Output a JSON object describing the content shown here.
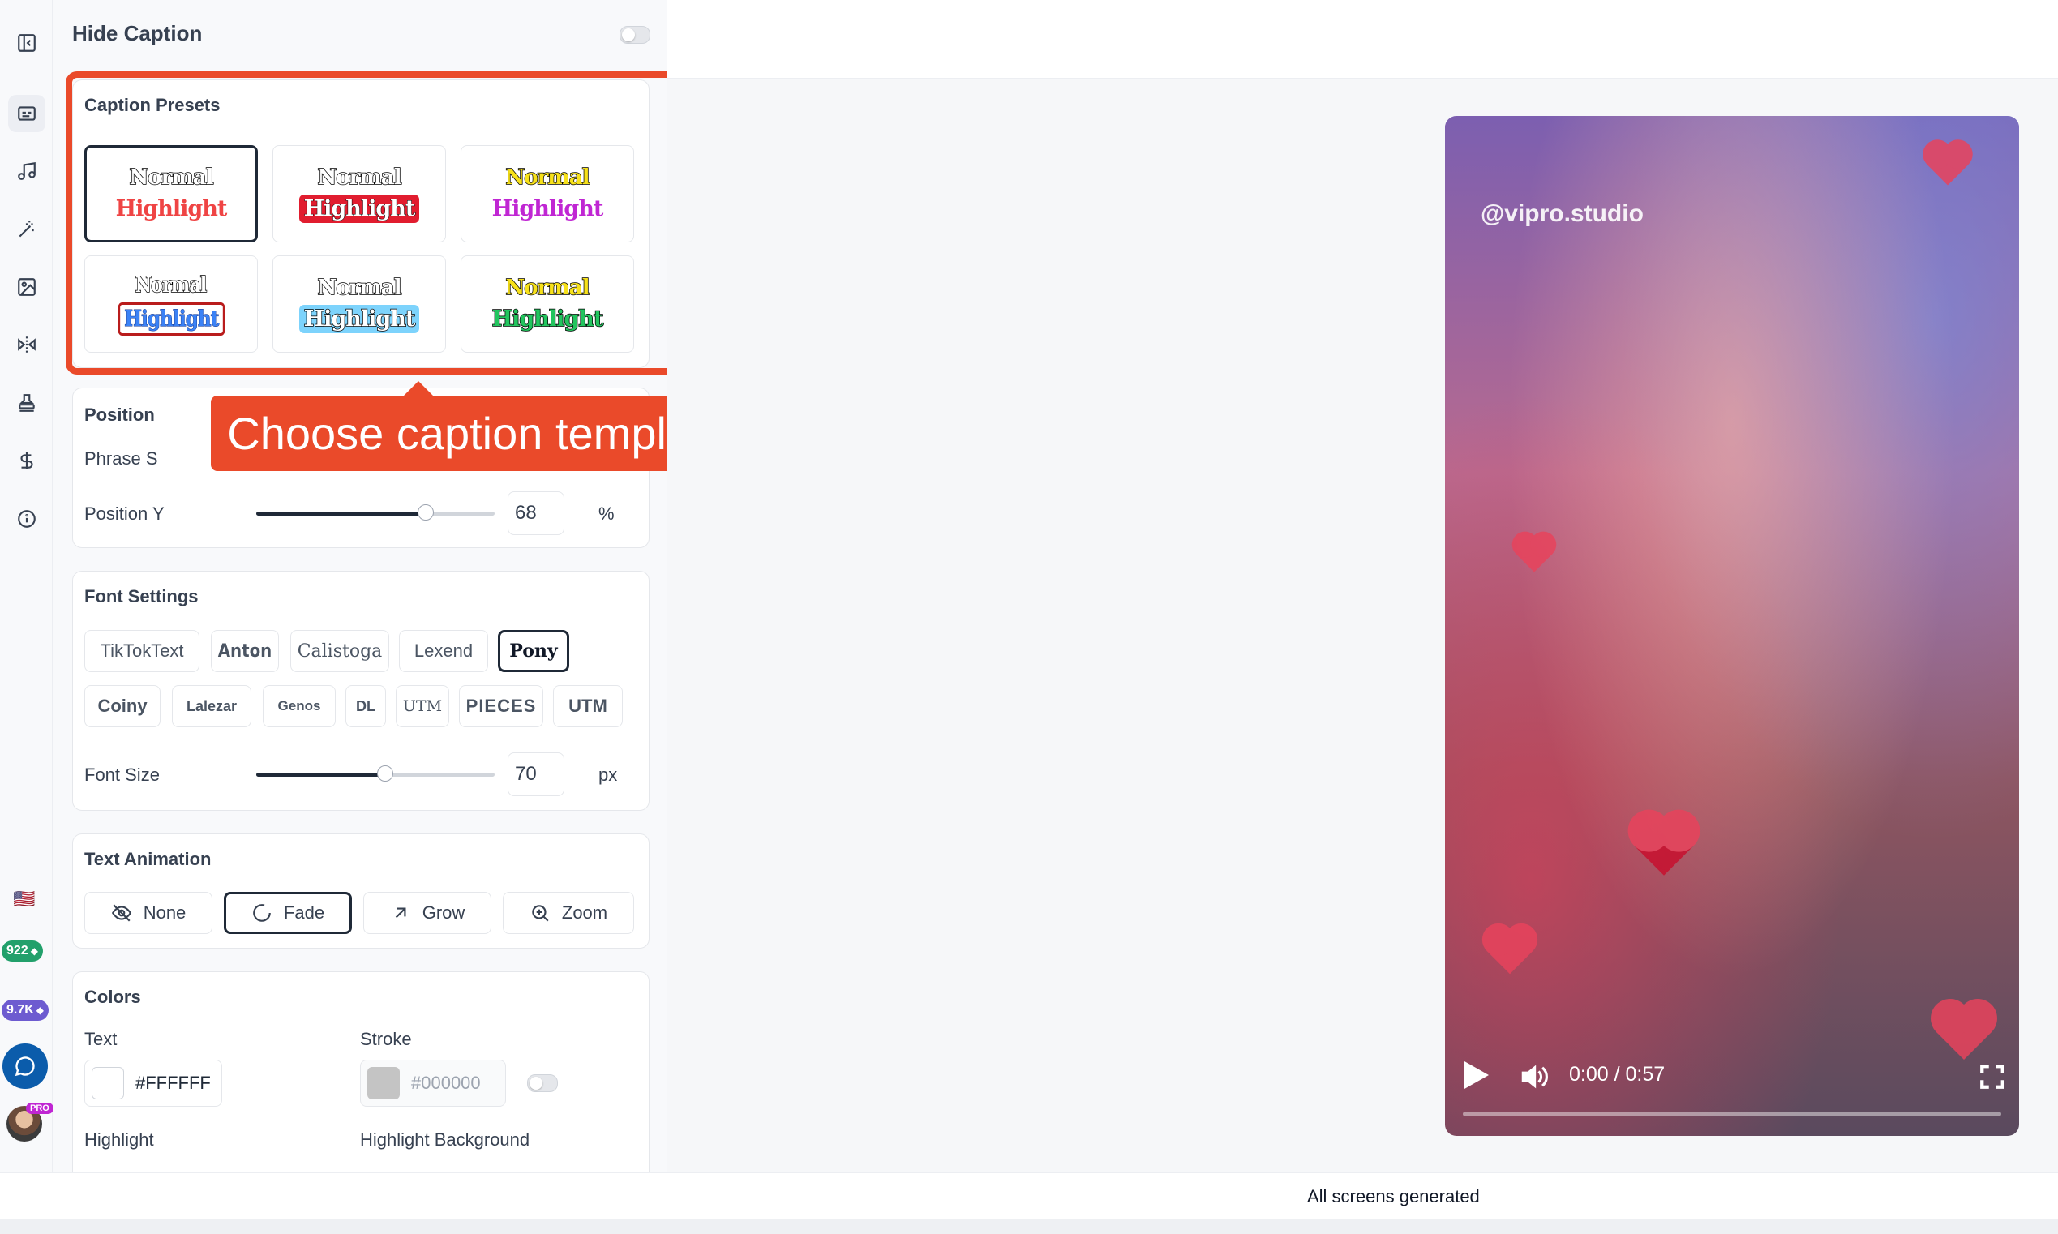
{
  "sidebar": {
    "icons": [
      "panel-collapse-icon",
      "captions-icon",
      "music-icon",
      "magic-wand-icon",
      "image-edit-icon",
      "flip-icon",
      "stamp-icon",
      "dollar-icon",
      "info-icon"
    ],
    "language_flag": "🇺🇸",
    "credits": [
      {
        "value": "922",
        "color": "#22a06b"
      },
      {
        "value": "9.7K",
        "color": "#6d5bd0"
      }
    ],
    "pro_badge": "PRO"
  },
  "panel": {
    "hide_caption_label": "Hide Caption",
    "caption_presets": {
      "title": "Caption Presets",
      "presets": [
        {
          "normal": "Normal",
          "highlight": "Highlight",
          "selected": true
        },
        {
          "normal": "Normal",
          "highlight": "Highlight",
          "selected": false
        },
        {
          "normal": "Normal",
          "highlight": "Highlight",
          "selected": false
        },
        {
          "normal": "Normal",
          "highlight": "Highlight",
          "selected": false
        },
        {
          "normal": "Normal",
          "highlight": "Highlight",
          "selected": false
        },
        {
          "normal": "Normal",
          "highlight": "Highlight",
          "selected": false
        }
      ]
    },
    "callout": "Choose caption template",
    "position": {
      "title": "Position",
      "phrase_label": "Phrase S",
      "position_y_label": "Position Y",
      "position_y_value": "68",
      "position_y_level": 0.71,
      "position_y_unit": "%"
    },
    "font_settings": {
      "title": "Font Settings",
      "fonts_row1": [
        "TikTokText",
        "Anton",
        "Calistoga",
        "Lexend",
        "Pony"
      ],
      "fonts_row2": [
        "Coiny",
        "Lalezar",
        "Genos",
        "DL",
        "UTM",
        "PIECES",
        "UTM"
      ],
      "selected_font": "Pony",
      "font_size_label": "Font Size",
      "font_size_value": "70",
      "font_size_level": 0.54,
      "font_size_unit": "px"
    },
    "text_animation": {
      "title": "Text Animation",
      "options": [
        "None",
        "Fade",
        "Grow",
        "Zoom"
      ],
      "selected": "Fade"
    },
    "colors": {
      "title": "Colors",
      "text_label": "Text",
      "text_value": "#FFFFFF",
      "stroke_label": "Stroke",
      "stroke_value": "#000000",
      "highlight_label": "Highlight",
      "highlight_bg_label": "Highlight Background"
    }
  },
  "preview": {
    "watermark": "@vipro.studio",
    "time": "0:00 / 0:57"
  },
  "status": {
    "text": "All screens generated"
  },
  "colors_theme": {
    "accent_callout": "#ea4a2a",
    "dark": "#1f2937"
  }
}
